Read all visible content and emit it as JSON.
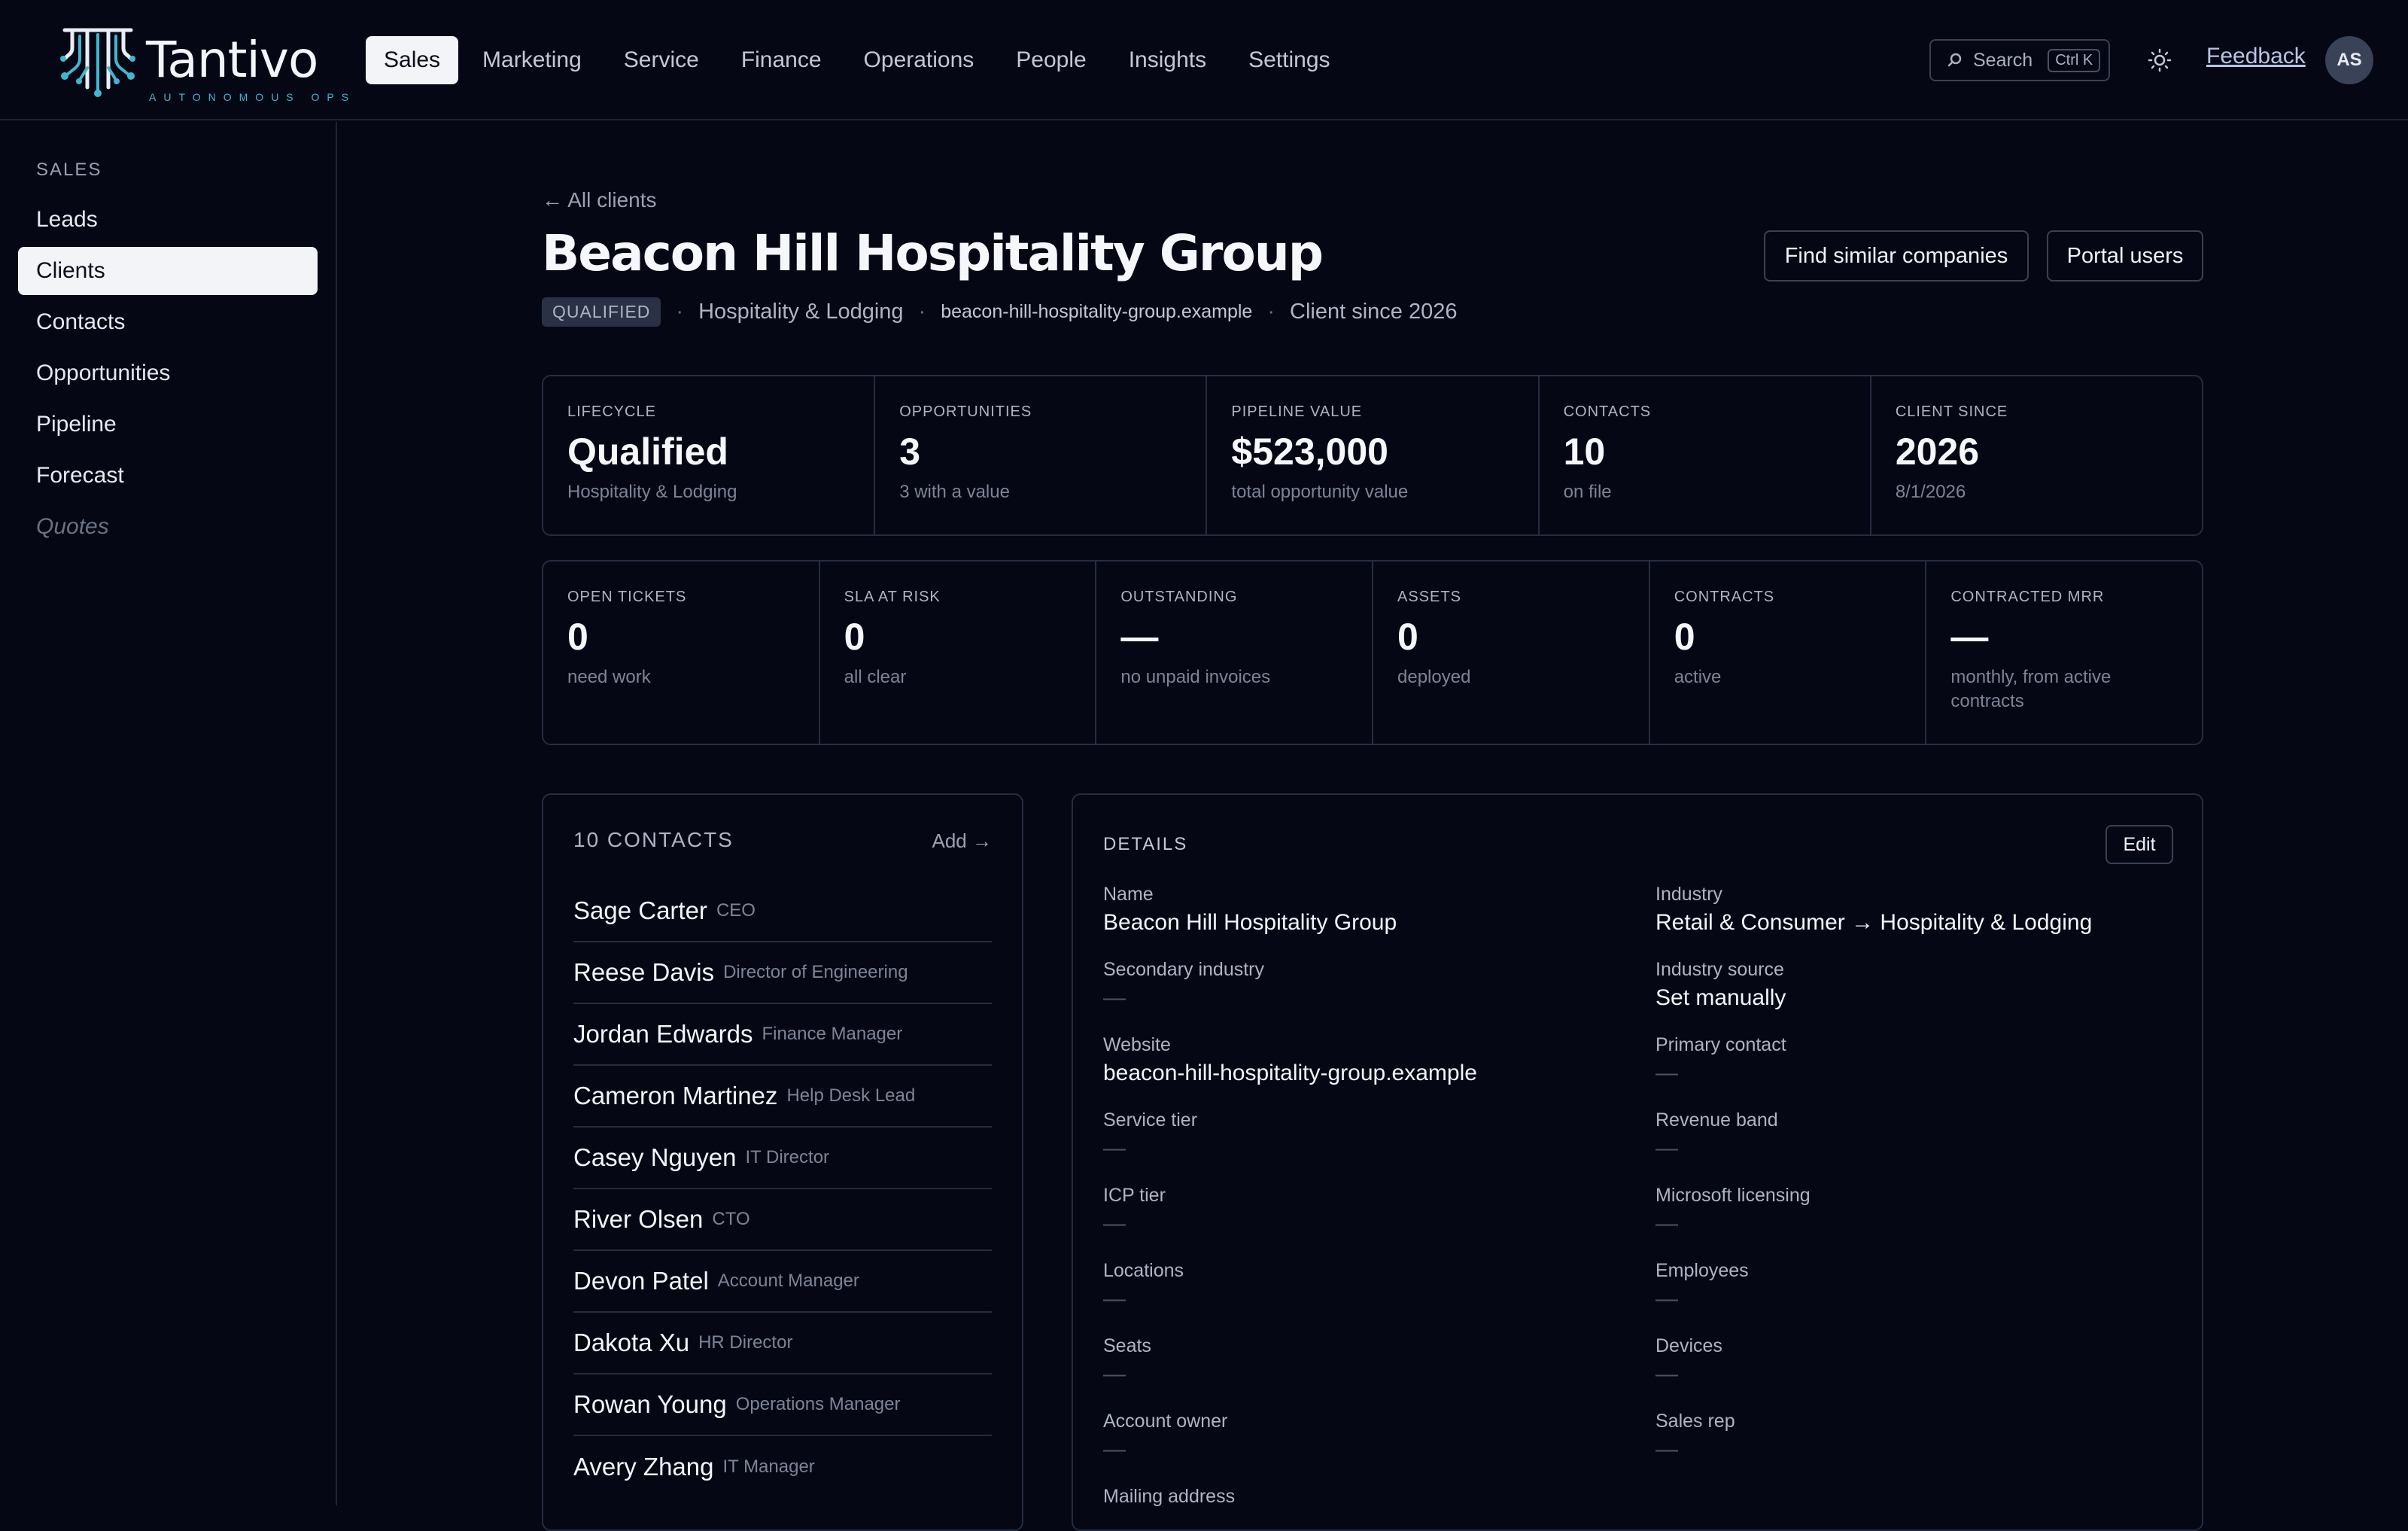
{
  "brand": {
    "name": "Tantivo",
    "tagline": "AUTONOMOUS OPS"
  },
  "nav": {
    "items": [
      {
        "label": "Sales",
        "active": true
      },
      {
        "label": "Marketing"
      },
      {
        "label": "Service"
      },
      {
        "label": "Finance"
      },
      {
        "label": "Operations"
      },
      {
        "label": "People"
      },
      {
        "label": "Insights"
      },
      {
        "label": "Settings"
      }
    ]
  },
  "search": {
    "label": "Search",
    "shortcut": "Ctrl K"
  },
  "feedback_label": "Feedback",
  "user": {
    "initials": "AS"
  },
  "sidebar": {
    "heading": "SALES",
    "items": [
      {
        "label": "Leads"
      },
      {
        "label": "Clients",
        "active": true
      },
      {
        "label": "Contacts"
      },
      {
        "label": "Opportunities"
      },
      {
        "label": "Pipeline"
      },
      {
        "label": "Forecast"
      },
      {
        "label": "Quotes",
        "muted": true
      }
    ]
  },
  "page": {
    "back_label": "← All clients",
    "title": "Beacon Hill Hospitality Group",
    "status_badge": "QUALIFIED",
    "industry": "Hospitality & Lodging",
    "domain": "beacon-hill-hospitality-group.example",
    "client_since": "Client since 2026",
    "actions": {
      "find_similar": "Find similar companies",
      "portal_users": "Portal users"
    }
  },
  "stats_row1": [
    {
      "label": "LIFECYCLE",
      "value": "Qualified",
      "sub": "Hospitality & Lodging"
    },
    {
      "label": "OPPORTUNITIES",
      "value": "3",
      "sub": "3 with a value"
    },
    {
      "label": "PIPELINE VALUE",
      "value": "$523,000",
      "sub": "total opportunity value"
    },
    {
      "label": "CONTACTS",
      "value": "10",
      "sub": "on file"
    },
    {
      "label": "CLIENT SINCE",
      "value": "2026",
      "sub": "8/1/2026"
    }
  ],
  "stats_row2": [
    {
      "label": "OPEN TICKETS",
      "value": "0",
      "sub": "need work"
    },
    {
      "label": "SLA AT RISK",
      "value": "0",
      "sub": "all clear"
    },
    {
      "label": "OUTSTANDING",
      "value": "—",
      "sub": "no unpaid invoices"
    },
    {
      "label": "ASSETS",
      "value": "0",
      "sub": "deployed"
    },
    {
      "label": "CONTRACTS",
      "value": "0",
      "sub": "active"
    },
    {
      "label": "CONTRACTED MRR",
      "value": "—",
      "sub": "monthly, from active contracts"
    }
  ],
  "contacts": {
    "title": "10 CONTACTS",
    "add_label": "Add →",
    "items": [
      {
        "name": "Sage Carter",
        "role": "CEO"
      },
      {
        "name": "Reese Davis",
        "role": "Director of Engineering"
      },
      {
        "name": "Jordan Edwards",
        "role": "Finance Manager"
      },
      {
        "name": "Cameron Martinez",
        "role": "Help Desk Lead"
      },
      {
        "name": "Casey Nguyen",
        "role": "IT Director"
      },
      {
        "name": "River Olsen",
        "role": "CTO"
      },
      {
        "name": "Devon Patel",
        "role": "Account Manager"
      },
      {
        "name": "Dakota Xu",
        "role": "HR Director"
      },
      {
        "name": "Rowan Young",
        "role": "Operations Manager"
      },
      {
        "name": "Avery Zhang",
        "role": "IT Manager"
      }
    ]
  },
  "details": {
    "title": "DETAILS",
    "edit_label": "Edit",
    "fields": [
      {
        "label": "Name",
        "value": "Beacon Hill Hospitality Group"
      },
      {
        "label": "Industry",
        "value": "Retail & Consumer → Hospitality & Lodging"
      },
      {
        "label": "Secondary industry",
        "value": "—"
      },
      {
        "label": "Industry source",
        "value": "Set manually"
      },
      {
        "label": "Website",
        "value": "beacon-hill-hospitality-group.example"
      },
      {
        "label": "Primary contact",
        "value": "—"
      },
      {
        "label": "Service tier",
        "value": "—"
      },
      {
        "label": "Revenue band",
        "value": "—"
      },
      {
        "label": "ICP tier",
        "value": "—"
      },
      {
        "label": "Microsoft licensing",
        "value": "—"
      },
      {
        "label": "Locations",
        "value": "—"
      },
      {
        "label": "Employees",
        "value": "—"
      },
      {
        "label": "Seats",
        "value": "—"
      },
      {
        "label": "Devices",
        "value": "—"
      },
      {
        "label": "Account owner",
        "value": "—"
      },
      {
        "label": "Sales rep",
        "value": "—"
      },
      {
        "label": "Mailing address",
        "value": ""
      }
    ]
  },
  "colors": {
    "background": "#050714",
    "accent": "#3fb7cf",
    "border": "#262c40"
  }
}
